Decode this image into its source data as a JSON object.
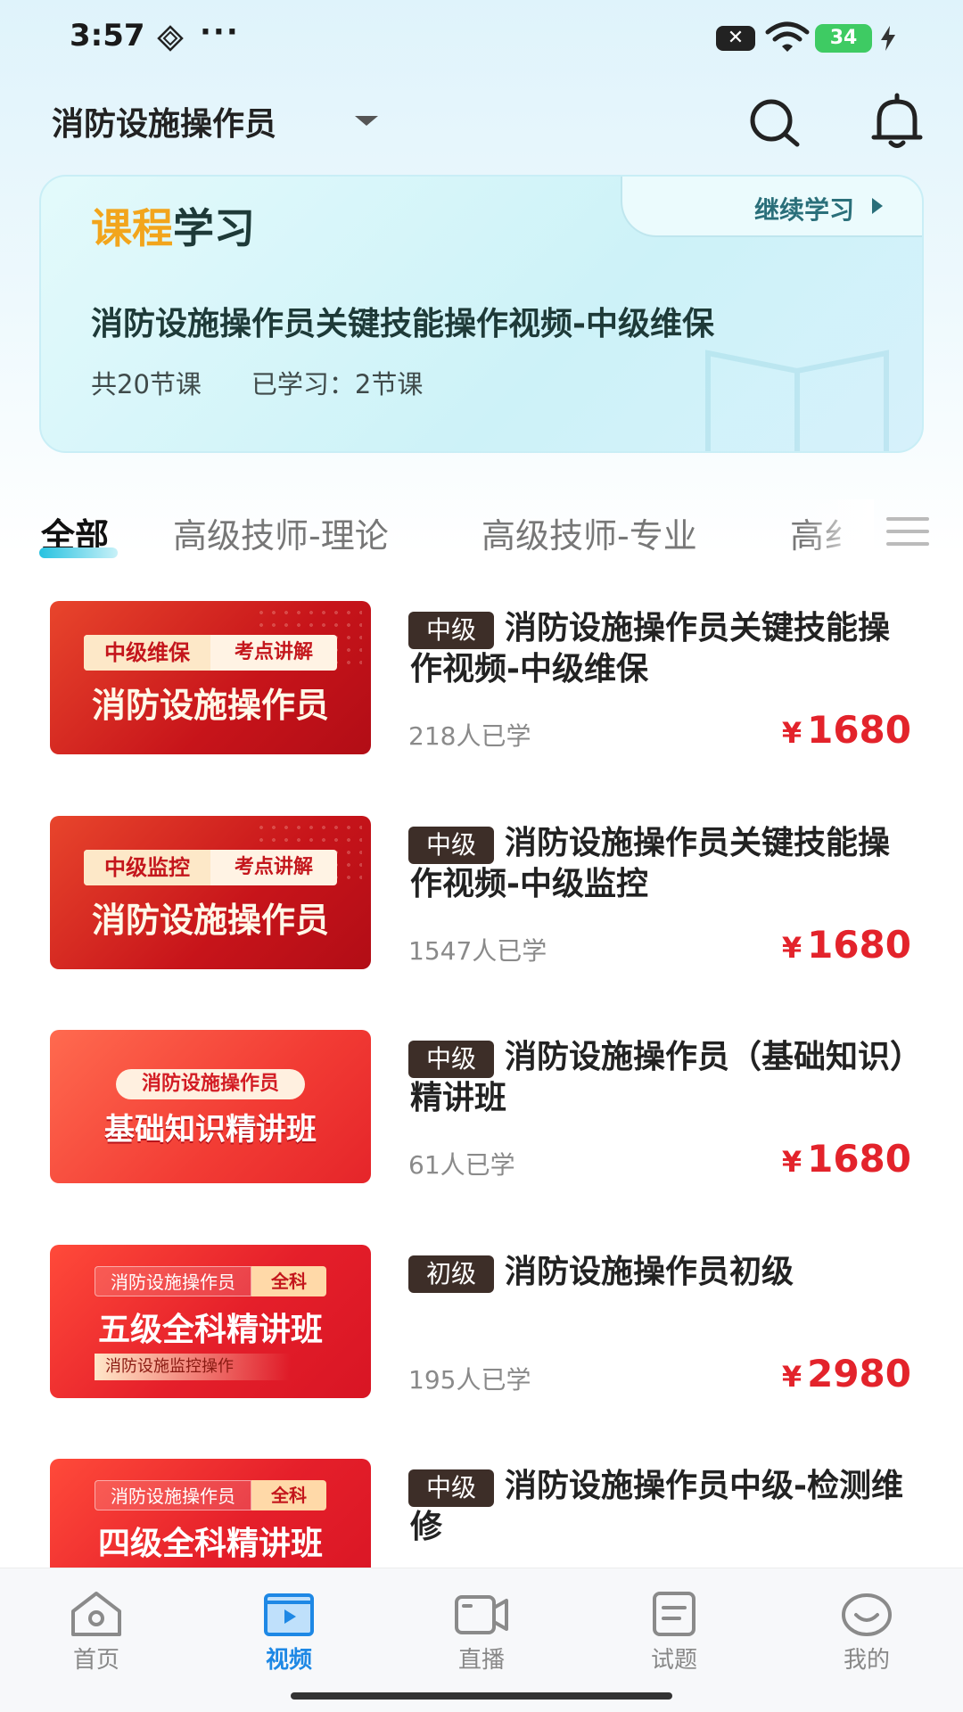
{
  "status_bar": {
    "time": "3:57",
    "dots": "···",
    "notification": "✕",
    "battery": "34"
  },
  "header": {
    "title": "消防设施操作员"
  },
  "study_card": {
    "heading_accent": "课程",
    "heading_rest": "学习",
    "continue_label": "继续学习",
    "course_name": "消防设施操作员关键技能操作视频-中级维保",
    "total_lessons": "共20节课",
    "studied": "已学习：2节课"
  },
  "tabs": [
    {
      "label": "全部",
      "active": true
    },
    {
      "label": "高级技师-理论",
      "active": false
    },
    {
      "label": "高级技师-专业",
      "active": false
    },
    {
      "label": "高纟",
      "active": false
    }
  ],
  "courses": [
    {
      "thumb": {
        "tag_a": "中级维保",
        "tag_b": "考点讲解",
        "big": "消防设施操作员"
      },
      "level": "中级",
      "title": "消防设施操作员关键技能操作视频-中级维保",
      "learners": "218人已学",
      "currency": "¥",
      "price": "1680"
    },
    {
      "thumb": {
        "tag_a": "中级监控",
        "tag_b": "考点讲解",
        "big": "消防设施操作员"
      },
      "level": "中级",
      "title": "消防设施操作员关键技能操作视频-中级监控",
      "learners": "1547人已学",
      "currency": "¥",
      "price": "1680"
    },
    {
      "thumb": {
        "pill": "消防设施操作员",
        "big": "基础知识精讲班"
      },
      "level": "中级",
      "title": "消防设施操作员（基础知识）精讲班",
      "learners": "61人已学",
      "currency": "¥",
      "price": "1680"
    },
    {
      "thumb": {
        "small_a": "消防设施操作员",
        "small_b": "全科",
        "big": "五级全科精讲班",
        "sub": "消防设施监控操作"
      },
      "level": "初级",
      "title": "消防设施操作员初级",
      "learners": "195人已学",
      "currency": "¥",
      "price": "2980"
    },
    {
      "thumb": {
        "small_a": "消防设施操作员",
        "small_b": "全科",
        "big": "四级全科精讲班"
      },
      "level": "中级",
      "title": "消防设施操作员中级-检测维修",
      "learners": "",
      "currency": "",
      "price": ""
    }
  ],
  "bottom_nav": [
    {
      "label": "首页",
      "icon": "home-icon",
      "active": false
    },
    {
      "label": "视频",
      "icon": "video-icon",
      "active": true
    },
    {
      "label": "直播",
      "icon": "live-camera-icon",
      "active": false
    },
    {
      "label": "试题",
      "icon": "exam-icon",
      "active": false
    },
    {
      "label": "我的",
      "icon": "profile-icon",
      "active": false
    }
  ],
  "colors": {
    "accent": "#1e88e5",
    "price": "#e3232b",
    "heading_accent": "#f2a51c",
    "level_badge": "#3d2e28"
  }
}
